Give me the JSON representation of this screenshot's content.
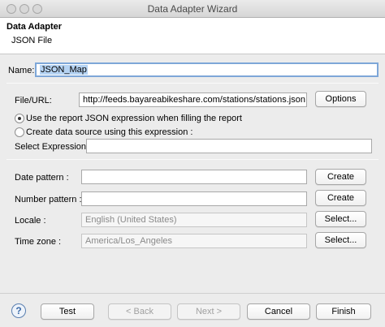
{
  "window": {
    "title": "Data Adapter Wizard"
  },
  "header": {
    "title": "Data Adapter",
    "subtitle": "JSON File"
  },
  "name": {
    "label": "Name:",
    "value": "JSON_Map"
  },
  "file": {
    "label": "File/URL:",
    "value": "http://feeds.bayareabikeshare.com/stations/stations.json",
    "button": "Options"
  },
  "radios": {
    "use_report": "Use the report JSON expression when filling the report",
    "create_ds": "Create data source using this expression :",
    "selected": "use_report"
  },
  "select_expression": {
    "label": "Select Expression :",
    "value": ""
  },
  "date_pattern": {
    "label": "Date pattern :",
    "value": "",
    "button": "Create"
  },
  "number_pattern": {
    "label": "Number pattern :",
    "value": "",
    "button": "Create"
  },
  "locale": {
    "label": "Locale :",
    "value": "English (United States)",
    "button": "Select..."
  },
  "timezone": {
    "label": "Time zone :",
    "value": "America/Los_Angeles",
    "button": "Select..."
  },
  "footer": {
    "help": "?",
    "test": "Test",
    "back": "< Back",
    "next": "Next >",
    "cancel": "Cancel",
    "finish": "Finish"
  }
}
